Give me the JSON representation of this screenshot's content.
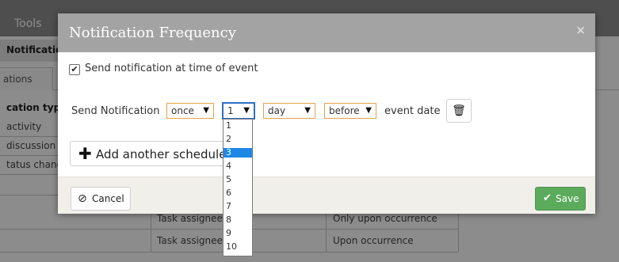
{
  "background": {
    "toolbar_label": "Tools",
    "section_heading": "Notificatio",
    "tab_label": "ations",
    "table": {
      "header": "cation type",
      "rows": [
        {
          "c1": "activity",
          "c2": "",
          "c3": ""
        },
        {
          "c1": "discussion b",
          "c2": "",
          "c3": ""
        },
        {
          "c1": "tatus chang",
          "c2": "",
          "c3": ""
        },
        {
          "c1": "",
          "c2": "",
          "c3": ""
        },
        {
          "c1": "",
          "c2": "Task assignee",
          "c3": "Only upon occurrence"
        },
        {
          "c1": "",
          "c2": "Task assignee",
          "c3": "Upon occurrence"
        }
      ]
    }
  },
  "modal": {
    "title": "Notification Frequency",
    "close_icon": "×",
    "checkbox": {
      "checked": true,
      "mark": "✔",
      "label": "Send notification at time of event"
    },
    "schedule": {
      "label": "Send Notification",
      "frequency": "once",
      "count": "1",
      "unit": "day",
      "relation": "before",
      "event_label": "event date",
      "select_arrow": "▼",
      "delete_icon": "🗑"
    },
    "add_button": {
      "icon": "✚",
      "label": "Add another schedule"
    },
    "footer": {
      "cancel_icon": "⊘",
      "cancel_label": "Cancel",
      "save_icon": "✔",
      "save_label": "Save"
    },
    "count_dropdown": {
      "options": [
        "1",
        "2",
        "3",
        "4",
        "5",
        "6",
        "7",
        "8",
        "9",
        "10"
      ],
      "list_top_entry": "1",
      "highlighted_index": 3
    }
  },
  "colors": {
    "accent_orange": "#e2a24c",
    "focus_blue": "#2d6fc4",
    "highlight_blue": "#1e88e5",
    "save_green": "#5cab5d",
    "header_gray": "#a3a3a3"
  }
}
